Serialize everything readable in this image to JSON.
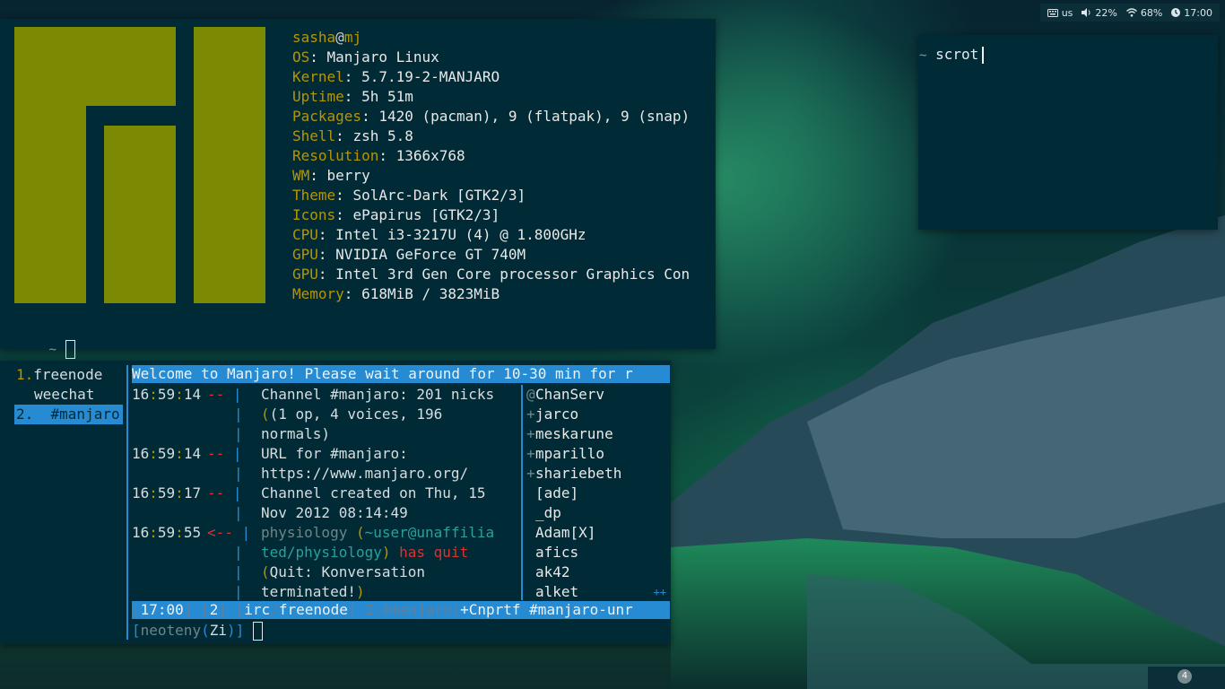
{
  "statusbar": {
    "keyboard_icon": "keyboard-icon",
    "keyboard_layout": "us",
    "volume_icon": "speaker-icon",
    "volume": "22%",
    "wifi_icon": "wifi-icon",
    "wifi": "68%",
    "clock_icon": "clock-icon",
    "time": "17:00"
  },
  "neofetch": {
    "user": "sasha",
    "at": "@",
    "host": "mj",
    "rows": [
      {
        "key": "OS",
        "value": "Manjaro Linux"
      },
      {
        "key": "Kernel",
        "value": "5.7.19-2-MANJARO"
      },
      {
        "key": "Uptime",
        "value": "5h 51m"
      },
      {
        "key": "Packages",
        "value": "1420 (pacman), 9 (flatpak), 9 (snap)"
      },
      {
        "key": "Shell",
        "value": "zsh 5.8"
      },
      {
        "key": "Resolution",
        "value": "1366x768"
      },
      {
        "key": "WM",
        "value": "berry"
      },
      {
        "key": "Theme",
        "value": "SolArc-Dark [GTK2/3]"
      },
      {
        "key": "Icons",
        "value": "ePapirus [GTK2/3]"
      },
      {
        "key": "CPU",
        "value": "Intel i3-3217U (4) @ 1.800GHz"
      },
      {
        "key": "GPU",
        "value": "NVIDIA GeForce GT 740M"
      },
      {
        "key": "GPU",
        "value": "Intel 3rd Gen Core processor Graphics Con"
      },
      {
        "key": "Memory",
        "value": "618MiB / 3823MiB"
      }
    ],
    "prompt": "~",
    "logo": "manjaro-logo",
    "logo_color": "#7c8a03"
  },
  "scrot_terminal": {
    "prompt": "~",
    "command": "scrot"
  },
  "weechat": {
    "buffers": [
      {
        "num": "1.",
        "name": "freenode"
      },
      {
        "num": "",
        "name": "weechat"
      },
      {
        "num": "2.",
        "name": "  #manjaro"
      }
    ],
    "topic": "Welcome to Manjaro! Please wait around for 10-30 min for r",
    "messages": [
      {
        "h": "16",
        "m": "59",
        "s": "14",
        "prefix": "--",
        "lines": [
          "Channel #manjaro: 201 nicks",
          "(1 op, 4 voices, 196",
          "normals)"
        ]
      },
      {
        "h": "16",
        "m": "59",
        "s": "14",
        "prefix": "--",
        "lines": [
          "URL for #manjaro:",
          "https://www.manjaro.org/"
        ]
      },
      {
        "h": "16",
        "m": "59",
        "s": "17",
        "prefix": "--",
        "lines": [
          "Channel created on Thu, 15",
          "Nov 2012 08:14:49"
        ]
      },
      {
        "h": "16",
        "m": "59",
        "s": "55",
        "prefix": "<--",
        "quit_nick": "physiology",
        "quit_host_1": "~user@unaffilia",
        "quit_host_2": "ted/physiology",
        "quit_word": "has quit",
        "quit_reason_1": "Quit: Konversation",
        "quit_reason_2": "terminated!"
      }
    ],
    "nicks": [
      {
        "mode": "@",
        "nick": "ChanServ"
      },
      {
        "mode": "+",
        "nick": "jarco"
      },
      {
        "mode": "+",
        "nick": "meskarune"
      },
      {
        "mode": "+",
        "nick": "mparillo"
      },
      {
        "mode": "+",
        "nick": "shariebeth"
      },
      {
        "mode": "",
        "nick": "[ade]"
      },
      {
        "mode": "",
        "nick": "_dp"
      },
      {
        "mode": "",
        "nick": "Adam[X]"
      },
      {
        "mode": "",
        "nick": "afics"
      },
      {
        "mode": "",
        "nick": "ak42"
      },
      {
        "mode": "",
        "nick": "alket"
      }
    ],
    "nick_more": "++",
    "status": {
      "time": "17:00",
      "buffer_num": "2",
      "server_type": "irc",
      "server": "freenode",
      "channel": "2:#manjaro",
      "modes": "+Cnprtf #manjaro-unr"
    },
    "input_nick": "neoteny",
    "input_mode": "Zi"
  },
  "workspace": "4"
}
